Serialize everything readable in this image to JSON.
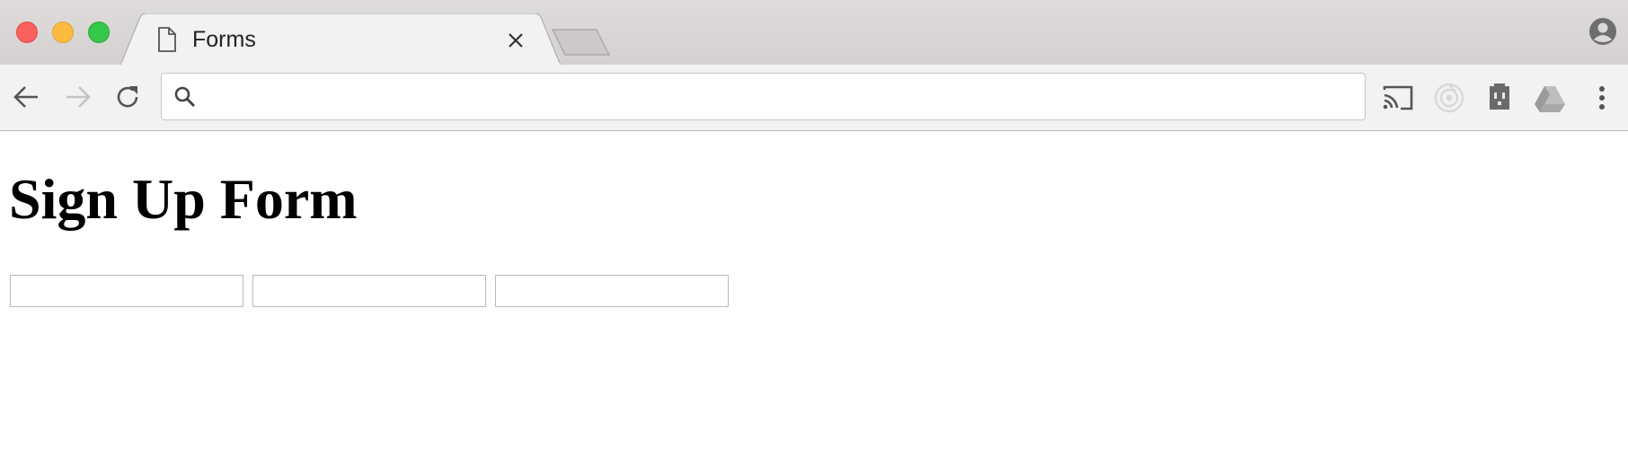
{
  "window": {
    "tab_title": "Forms",
    "tab_icon": "document-icon"
  },
  "toolbar": {
    "back_icon": "arrow-left-icon",
    "forward_icon": "arrow-right-icon",
    "reload_icon": "reload-icon",
    "omnibox_value": "",
    "omnibox_placeholder": "",
    "extensions": [
      "cast-icon",
      "target-icon",
      "outlet-icon",
      "drive-icon",
      "more-vert-icon"
    ]
  },
  "page": {
    "title": "Sign Up Form",
    "fields": [
      {
        "value": "",
        "placeholder": ""
      },
      {
        "value": "",
        "placeholder": ""
      },
      {
        "value": "",
        "placeholder": ""
      }
    ]
  },
  "colors": {
    "close": "#fc605c",
    "minimize": "#fdbc40",
    "maximize": "#34c84a",
    "toolbar_bg": "#f2f2f2",
    "tabstrip_bg": "#d8d4d4"
  }
}
